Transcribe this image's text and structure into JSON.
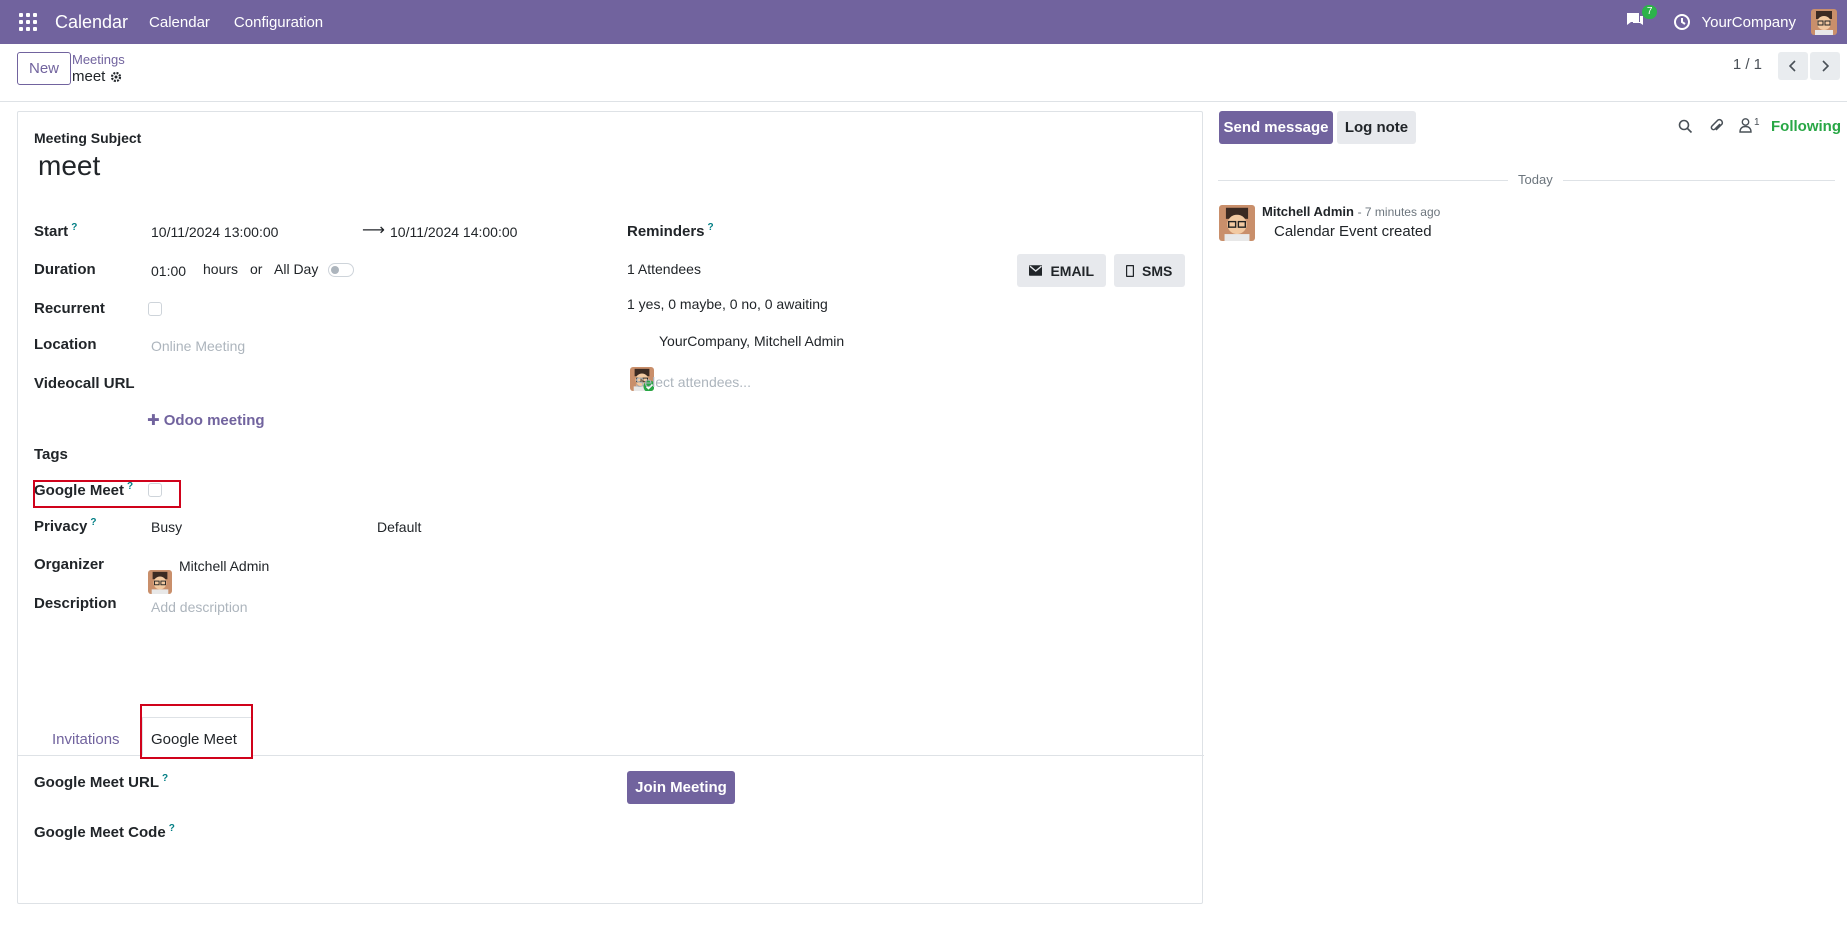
{
  "navbar": {
    "app_name": "Calendar",
    "menu": [
      "Calendar",
      "Configuration"
    ],
    "messages_count": "7",
    "company": "YourCompany"
  },
  "control": {
    "new_label": "New",
    "breadcrumb": "Meetings",
    "record_name": "meet",
    "pager": "1 / 1"
  },
  "form": {
    "subject_label": "Meeting Subject",
    "subject": "meet",
    "start_label": "Start",
    "start_value": "10/11/2024 13:00:00",
    "end_value": "10/11/2024 14:00:00",
    "duration_label": "Duration",
    "duration_value": "01:00",
    "hours_text": "hours",
    "or_text": "or",
    "allday_label": "All Day",
    "recurrent_label": "Recurrent",
    "location_label": "Location",
    "location_placeholder": "Online Meeting",
    "videocall_label": "Videocall URL",
    "odoo_meeting_label": "Odoo meeting",
    "tags_label": "Tags",
    "google_meet_label": "Google Meet",
    "privacy_label": "Privacy",
    "privacy_value": "Busy",
    "privacy_default": "Default",
    "organizer_label": "Organizer",
    "organizer_value": "Mitchell Admin",
    "description_label": "Description",
    "description_placeholder": "Add description",
    "reminders_label": "Reminders",
    "attendees_count": "1 Attendees",
    "email_label": "EMAIL",
    "sms_label": "SMS",
    "attendees_status": "1 yes, 0 maybe, 0 no, 0 awaiting",
    "attendee_name": "YourCompany, Mitchell Admin",
    "attendees_placeholder": "Select attendees...",
    "tabs": [
      "Invitations",
      "Google Meet"
    ],
    "gmeet_url_label": "Google Meet URL",
    "gmeet_code_label": "Google Meet Code",
    "join_label": "Join Meeting"
  },
  "chatter": {
    "send_message": "Send message",
    "log_note": "Log note",
    "followers_count": "1",
    "following": "Following",
    "today": "Today",
    "author": "Mitchell Admin",
    "time": "- 7 minutes ago",
    "message": "Calendar Event created"
  },
  "colors": {
    "brand": "#71639e",
    "highlight": "#d0021b",
    "following": "#28a745"
  }
}
